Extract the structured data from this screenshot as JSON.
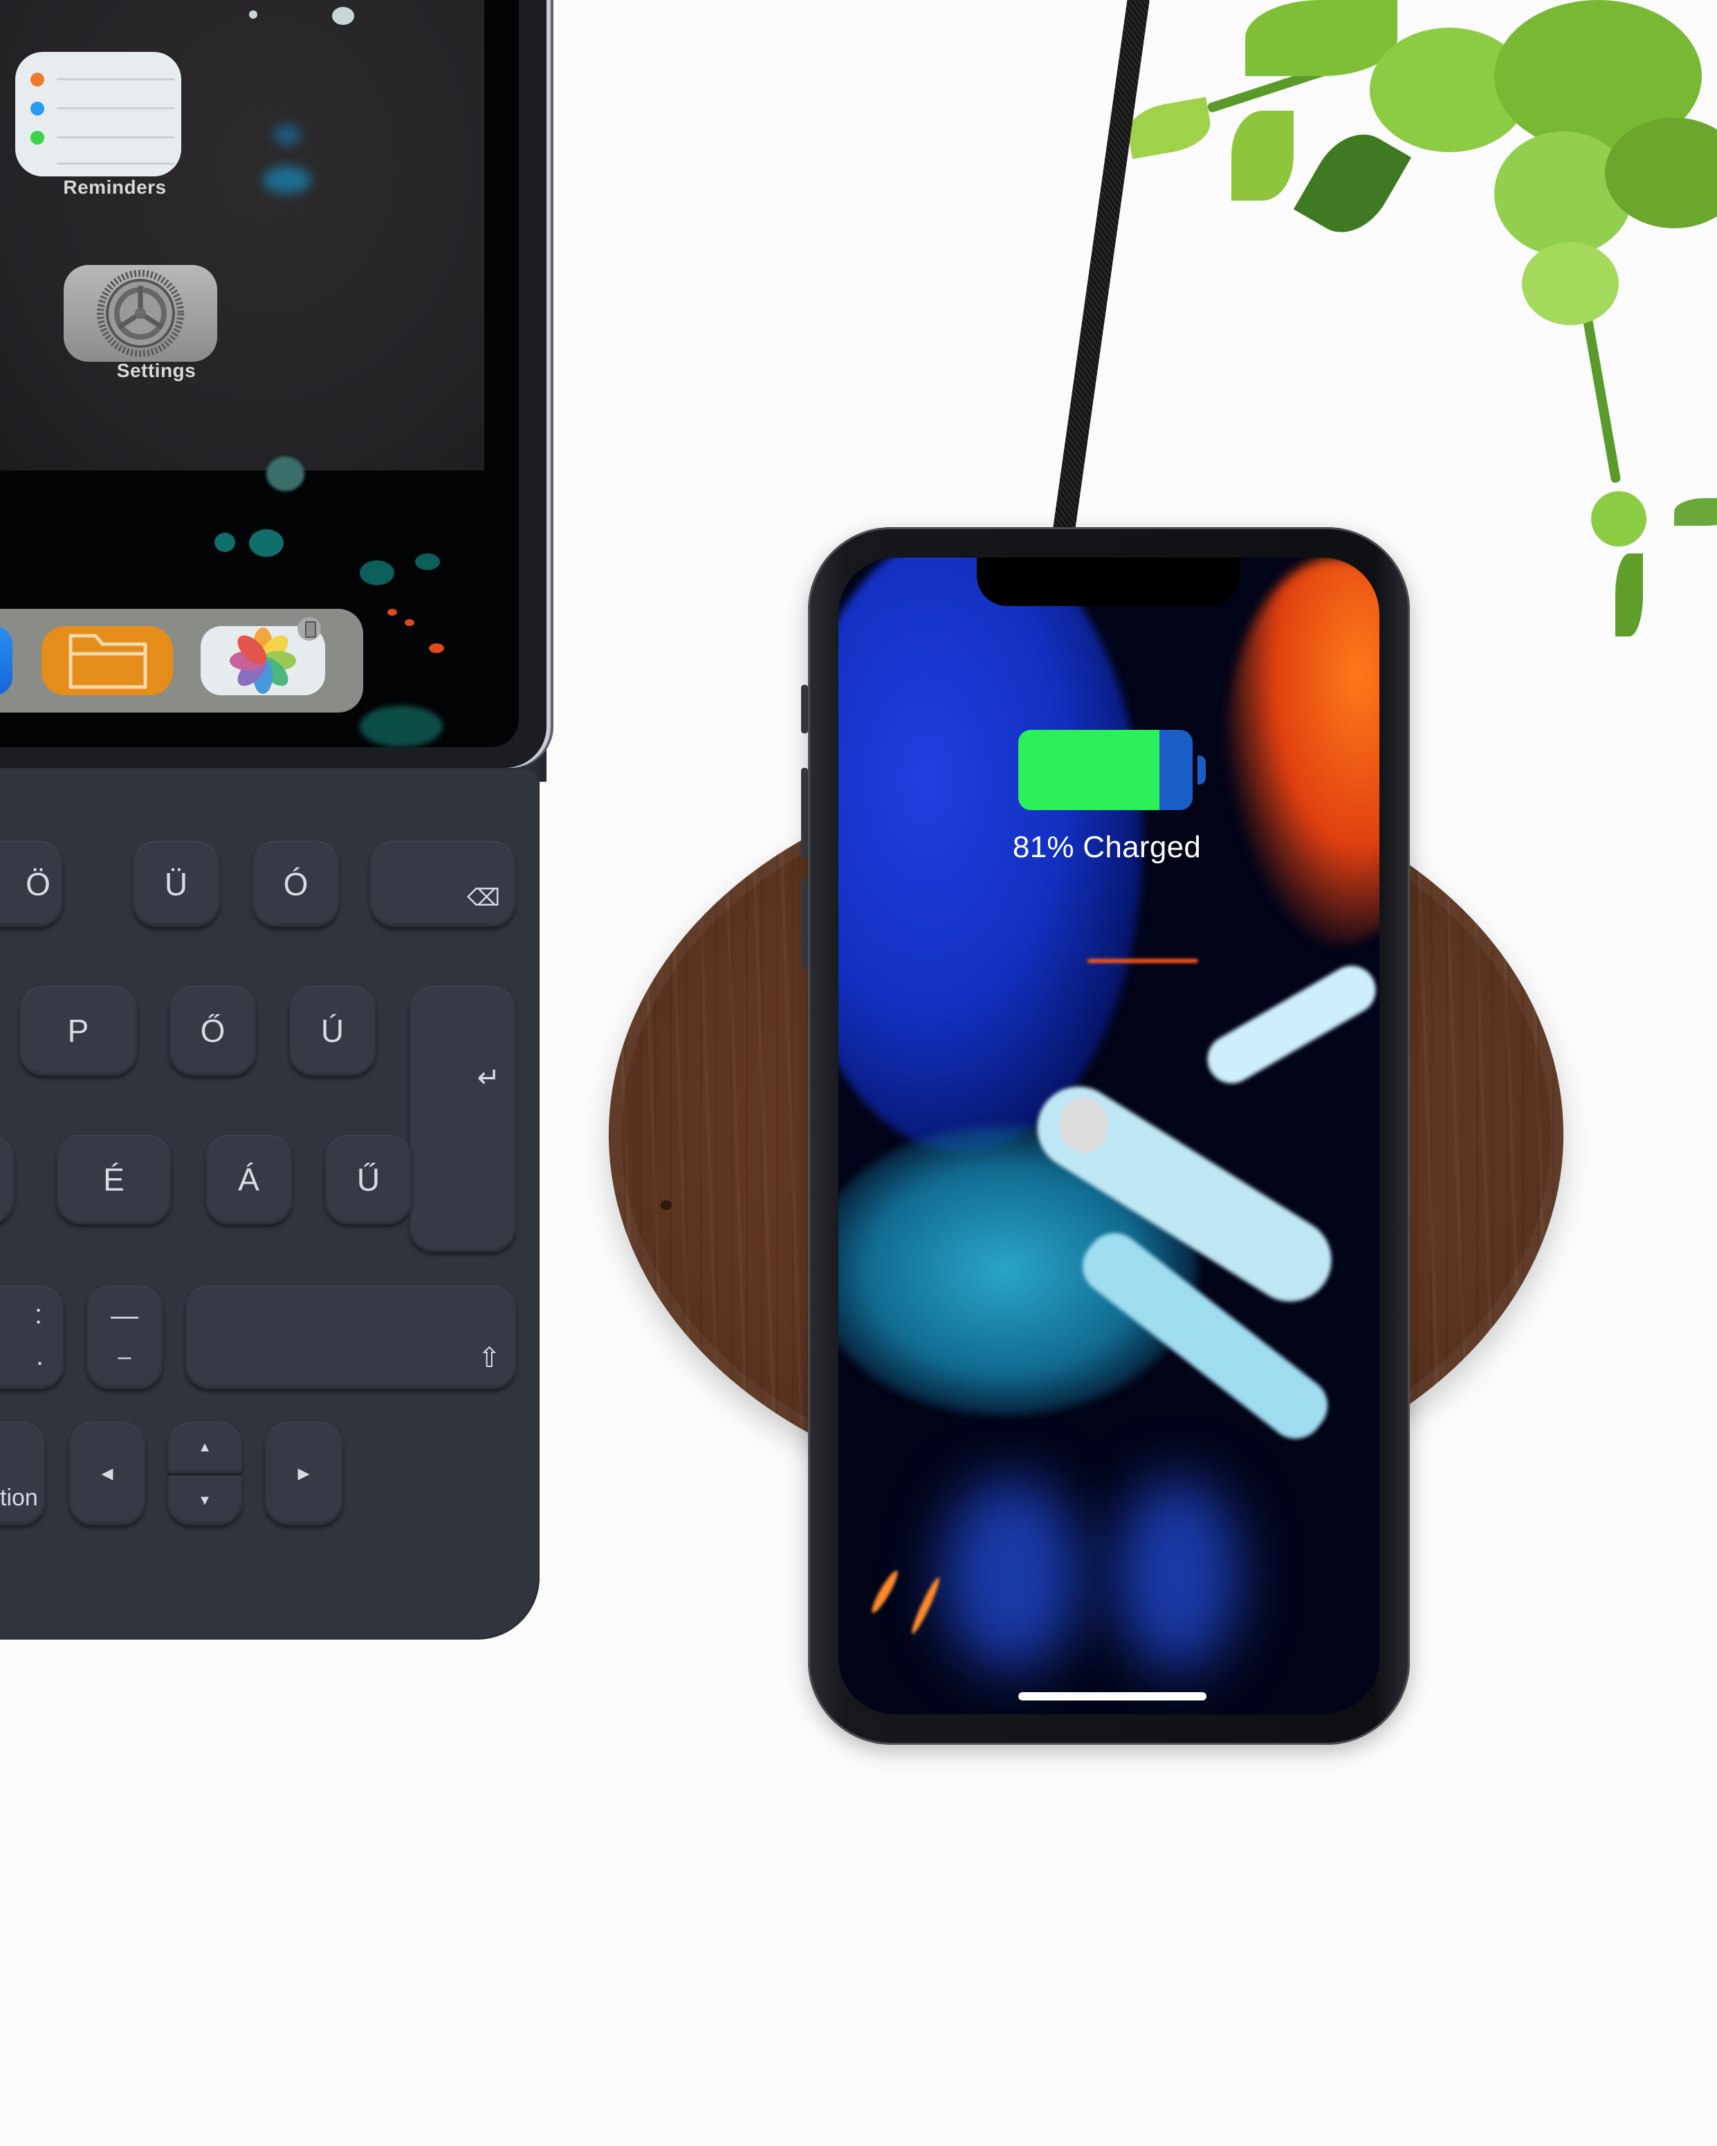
{
  "ipad": {
    "home_screen": {
      "apps": [
        {
          "name": "Reminders",
          "label": "Reminders",
          "icon": "reminders-icon"
        },
        {
          "name": "Settings",
          "label": "Settings",
          "icon": "gear-icon"
        }
      ]
    },
    "dock": {
      "apps": [
        {
          "name": "partially visible app",
          "icon": "app-icon"
        },
        {
          "name": "Files",
          "icon": "folder-icon"
        },
        {
          "name": "Photos",
          "icon": "photos-icon",
          "badge_icon": "iphone-icon"
        }
      ]
    }
  },
  "keyboard": {
    "rows": [
      [
        "Ö",
        "Ü",
        "Ó",
        "⌫"
      ],
      [
        "P",
        "Ő",
        "Ú",
        "↵"
      ],
      [
        "É",
        "Á",
        "Ű"
      ],
      [
        ": .",
        "— _",
        "⇧"
      ],
      [
        "option",
        "◀",
        "▲ ▼",
        "▶"
      ]
    ],
    "labels": {
      "o_umlaut": "Ö",
      "u_umlaut": "Ü",
      "o_acute": "Ó",
      "p": "P",
      "o_double_acute": "Ő",
      "u_acute": "Ú",
      "e_acute": "É",
      "a_acute": "Á",
      "u_double_acute": "Ű",
      "colon_top": ":",
      "colon_bottom": ".",
      "dash_top": "—",
      "dash_bottom": "–",
      "option_partial": "tion",
      "arrow_left": "◀",
      "arrow_up": "▲",
      "arrow_down": "▼",
      "arrow_right": "▶",
      "backspace": "⌫",
      "return": "↵",
      "shift": "⇧"
    }
  },
  "phone": {
    "charging": {
      "percent": 81,
      "status_text": "81% Charged",
      "fill_color": "#2bf05a",
      "empty_color": "#1a5fc7"
    },
    "home_indicator": true
  },
  "colors": {
    "background": "#fbfbfb",
    "keyboard": "#30343d",
    "wood": "#5f3621",
    "files_orange": "#e58d1a"
  }
}
